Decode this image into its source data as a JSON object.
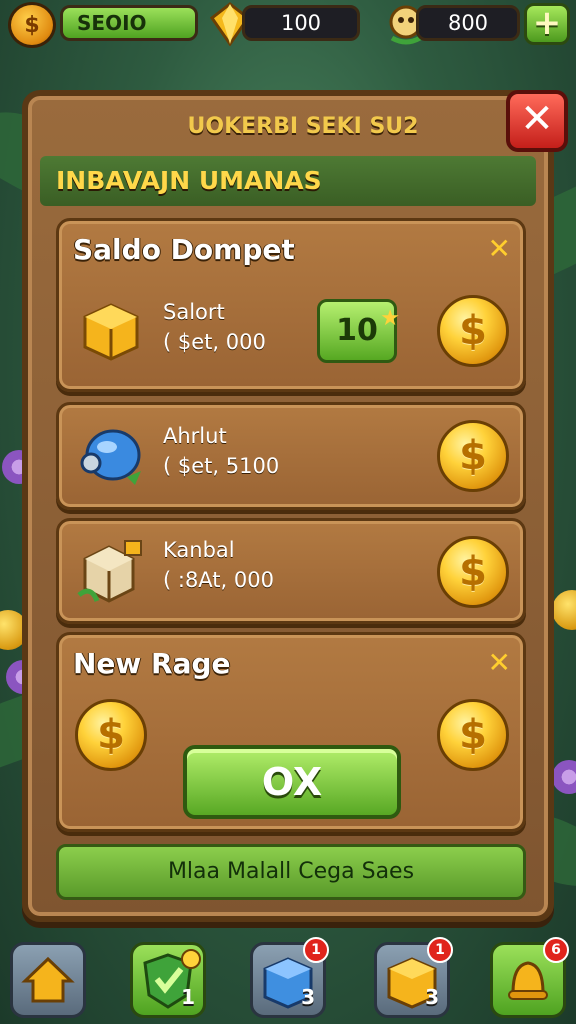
{
  "topbar": {
    "player_name": "SEOIO",
    "gems": "100",
    "coins": "800",
    "add_label": "+"
  },
  "panel": {
    "title": "UOKERBI SEKI SU2",
    "close_label": "✕",
    "section_title": "INBAVAJN UMANAS"
  },
  "wallet": {
    "heading": "Saldo Dompet",
    "dismiss_label": "✕",
    "items": [
      {
        "icon": "gold-box-icon",
        "name": "Salort",
        "price": "( $et, 000",
        "count": "10"
      },
      {
        "icon": "blue-orb-icon",
        "name": "Ahrlut",
        "price": "( $et, 5100"
      },
      {
        "icon": "crate-icon",
        "name": "Kanbal",
        "price": "( :8At, 000"
      }
    ],
    "coin_glyph": "$"
  },
  "new_range": {
    "heading": "New Rage",
    "dismiss_label": "✕",
    "ok_label": "OX"
  },
  "footer": {
    "label": "Mlaa Malall Cega Saes"
  },
  "bottom_nav": [
    {
      "icon": "home-icon",
      "number": "",
      "badge": ""
    },
    {
      "icon": "shield-check-icon",
      "number": "1",
      "badge": ""
    },
    {
      "icon": "blue-crate-icon",
      "number": "3",
      "badge": "1"
    },
    {
      "icon": "gold-crate-icon",
      "number": "3",
      "badge": "1"
    },
    {
      "icon": "bell-icon",
      "number": "",
      "badge": "6"
    }
  ],
  "colors": {
    "accent_green": "#58a824",
    "wood": "#9a6434",
    "gold": "#ffd23a",
    "close_red": "#c41f1a"
  }
}
